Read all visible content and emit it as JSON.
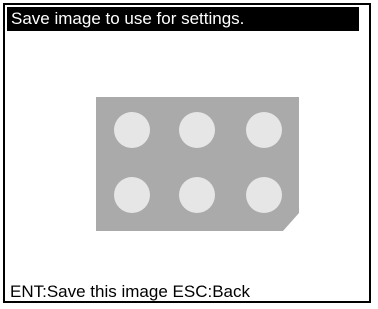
{
  "screen": {
    "title": "Save image to use for settings.",
    "footer": "ENT:Save this image ESC:Back"
  },
  "preview": {
    "description_name": "workpiece-image",
    "plate_color": "#aaaaaa",
    "hole_color": "#e6e6e6",
    "hole_grid": {
      "rows": 2,
      "columns": 3
    }
  }
}
